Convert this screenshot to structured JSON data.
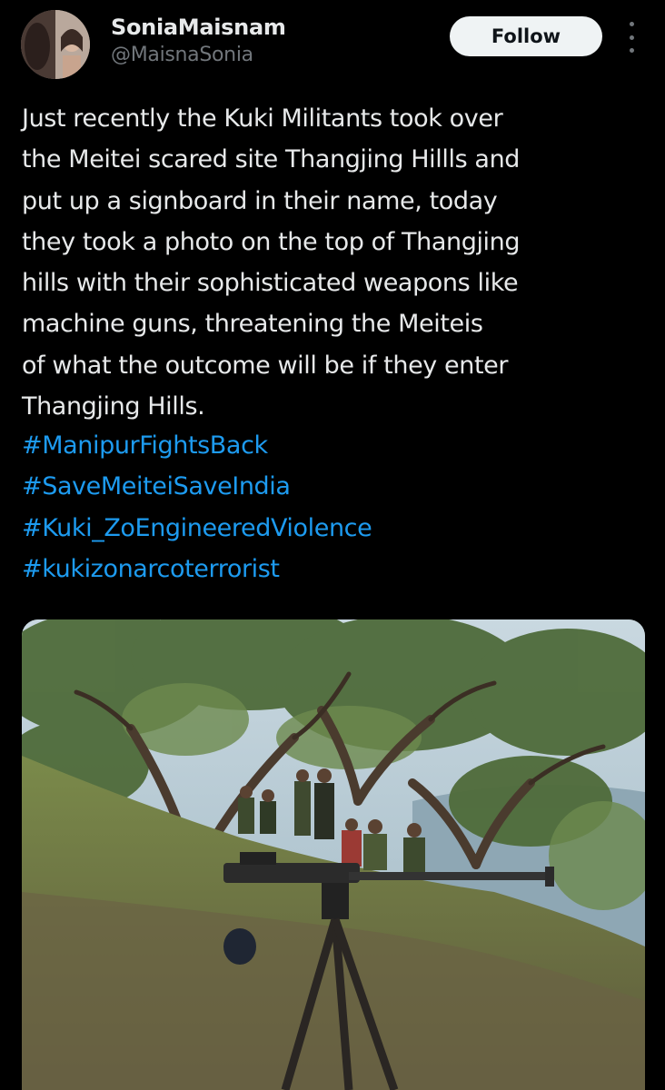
{
  "author": {
    "display_name": "SoniaMaisnam",
    "handle": "@MaisnaSonia",
    "follow_label": "Follow"
  },
  "tweet": {
    "text": "Just recently the Kuki Militants took over\nthe Meitei scared site Thangjing Hillls and\nput up a signboard in their name, today\nthey took a photo on the top of Thangjing\nhills with their sophisticated weapons like\nmachine guns, threatening the Meiteis\nof what the outcome will be if they enter\nThangjing Hills.",
    "hashtags": [
      "#ManipurFightsBack",
      "#SaveMeiteiSaveIndia",
      "#Kuki_ZoEngineeredViolence",
      "#kukizonarcoterrorist"
    ]
  },
  "colors": {
    "background": "#000000",
    "text": "#e7e9ea",
    "secondary_text": "#71767b",
    "link": "#1d9bf0",
    "follow_bg": "#eff3f4"
  },
  "icons": {
    "more": "more-vertical-icon"
  }
}
